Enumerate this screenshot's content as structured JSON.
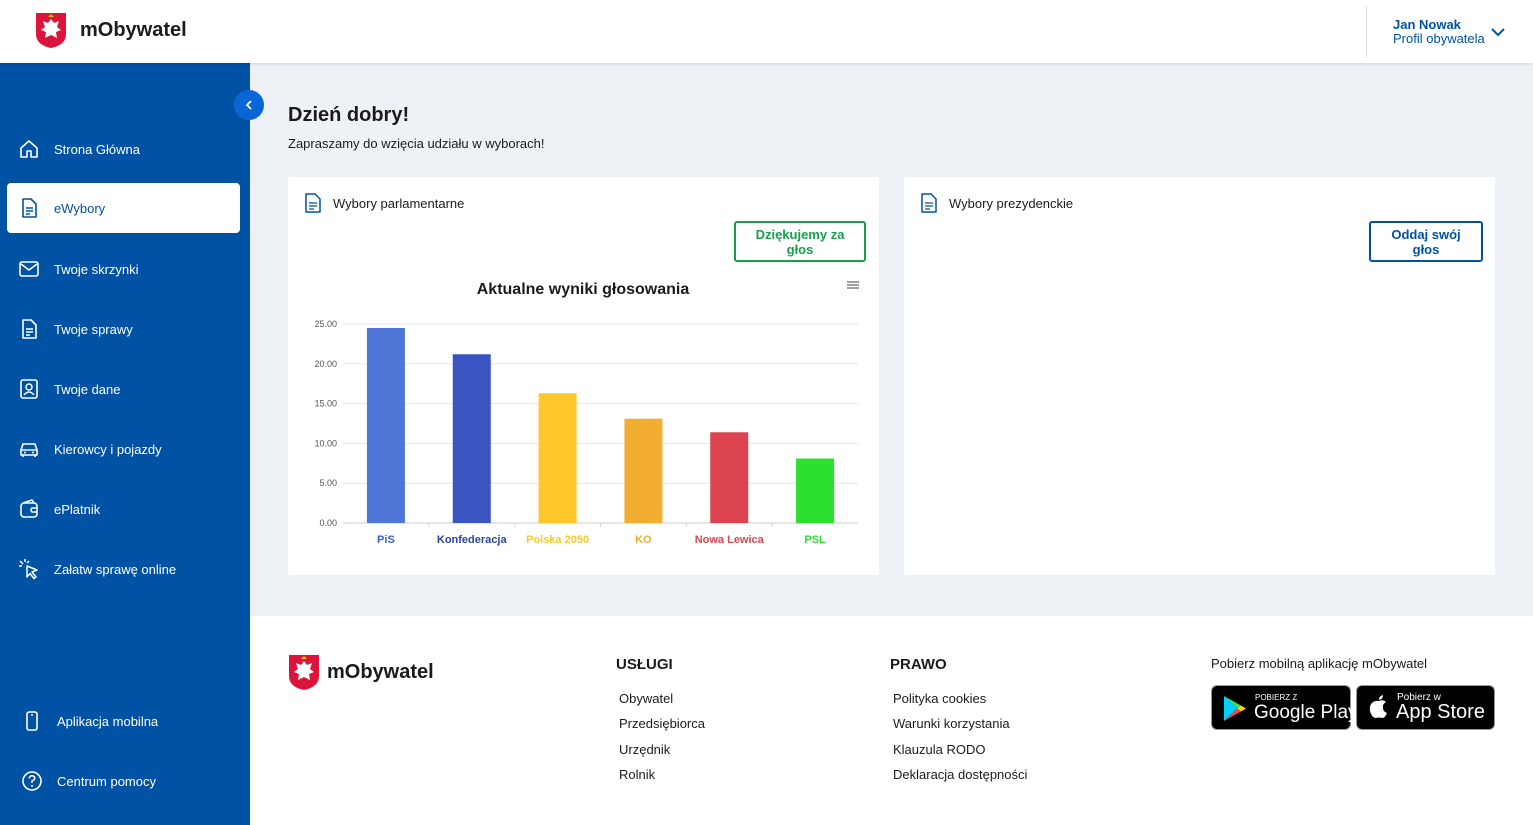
{
  "header": {
    "brand": "mObywatel",
    "user_name": "Jan Nowak",
    "user_role": "Profil obywatela"
  },
  "sidebar": {
    "items": [
      {
        "label": "Strona Główna",
        "icon": "home-icon"
      },
      {
        "label": "eWybory",
        "icon": "document-icon",
        "active": true
      },
      {
        "label": "Twoje skrzynki",
        "icon": "mail-icon"
      },
      {
        "label": "Twoje sprawy",
        "icon": "document-icon"
      },
      {
        "label": "Twoje dane",
        "icon": "person-icon"
      },
      {
        "label": "Kierowcy i pojazdy",
        "icon": "car-icon"
      },
      {
        "label": "ePlatnik",
        "icon": "wallet-icon"
      },
      {
        "label": "Załatw sprawę online",
        "icon": "cursor-click-icon"
      }
    ],
    "bottom_items": [
      {
        "label": "Aplikacja mobilna",
        "icon": "phone-icon"
      },
      {
        "label": "Centrum pomocy",
        "icon": "help-icon"
      }
    ]
  },
  "main": {
    "greeting": "Dzień dobry!",
    "subtitle": "Zapraszamy do wzięcia udziału w wyborach!",
    "cards": [
      {
        "title": "Wybory parlamentarne",
        "button": "Dziękujemy za głos"
      },
      {
        "title": "Wybory prezydenckie",
        "button": "Oddaj swój głos"
      }
    ]
  },
  "chart_data": {
    "type": "bar",
    "title": "Aktualne wyniki głosowania",
    "categories": [
      "PiS",
      "Konfederacja",
      "Polska 2050",
      "KO",
      "Nowa Lewica",
      "PSL"
    ],
    "values": [
      24.5,
      21.2,
      16.3,
      13.1,
      11.4,
      8.1
    ],
    "colors": [
      "#5077d8",
      "#3a54c2",
      "#fec72a",
      "#f2ae30",
      "#dc4550",
      "#2ae12e"
    ],
    "ylim": [
      0,
      25
    ],
    "yticks": [
      "0.00",
      "5.00",
      "10.00",
      "15.00",
      "20.00",
      "25.00"
    ],
    "grid": true,
    "xlabel": "",
    "ylabel": ""
  },
  "footer": {
    "brand": "mObywatel",
    "uslugi": {
      "title": "USŁUGI",
      "links": [
        "Obywatel",
        "Przedsiębiorca",
        "Urzędnik",
        "Rolnik"
      ]
    },
    "prawo": {
      "title": "PRAWO",
      "links": [
        "Polityka cookies",
        "Warunki korzystania",
        "Klauzula RODO",
        "Deklaracja dostępności"
      ]
    },
    "apps": {
      "title": "Pobierz mobilną aplikację mObywatel",
      "google_small": "POBIERZ Z",
      "google_big": "Google Play",
      "apple_small": "Pobierz w",
      "apple_big": "App Store"
    }
  },
  "colors": {
    "primary": "#0052a5",
    "success": "#17a04b",
    "background": "#eef2f7"
  }
}
